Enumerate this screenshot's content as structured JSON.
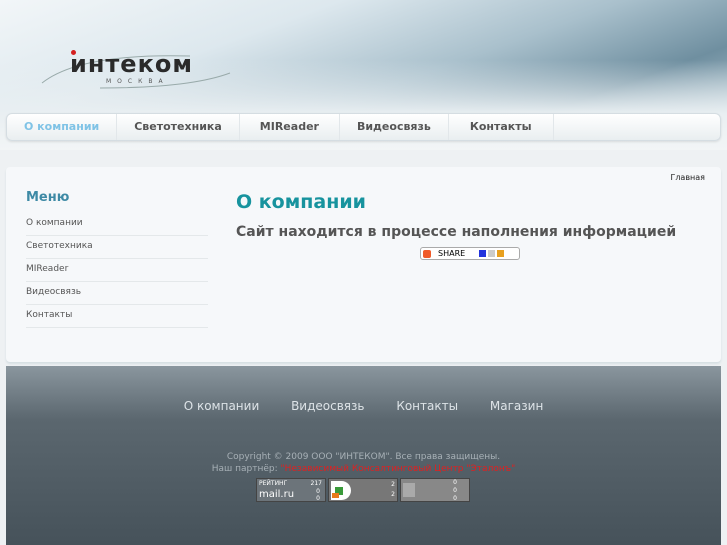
{
  "logo": {
    "name": "интеком",
    "city": "МОСКВА"
  },
  "nav": [
    "О компании",
    "Светотехника",
    "MIReader",
    "Видеосвязь",
    "Контакты"
  ],
  "breadcrumb": "Главная",
  "sidebar": {
    "title": "Меню",
    "items": [
      "О компании",
      "Светотехника",
      "MIReader",
      "Видеосвязь",
      "Контакты"
    ]
  },
  "main": {
    "title": "О компании",
    "subtitle": "Сайт находится в процессе наполнения информацией",
    "share_label": "SHARE"
  },
  "footer": {
    "nav": [
      "О компании",
      "Видеосвязь",
      "Контакты",
      "Магазин"
    ],
    "copyright": "Copyright © 2009 ООО \"ИНТЕКОМ\". Все права защищены.",
    "partner_label": "Наш партнёр: ",
    "partner_link": "\"Независимый Консалтинговый Центр \"Эталонъ\"",
    "counters": {
      "mail_title": "РЕЙТИНГ",
      "mail_value": "217",
      "mail_brand": "mail.ru",
      "mail_small": [
        "0",
        "0"
      ],
      "liveinternet": [
        "2",
        "2"
      ],
      "stats": [
        "0",
        "0",
        "0"
      ]
    }
  },
  "colors": {
    "accent": "#17939e",
    "active_nav": "#7fc3e6",
    "partner": "#e02020"
  }
}
